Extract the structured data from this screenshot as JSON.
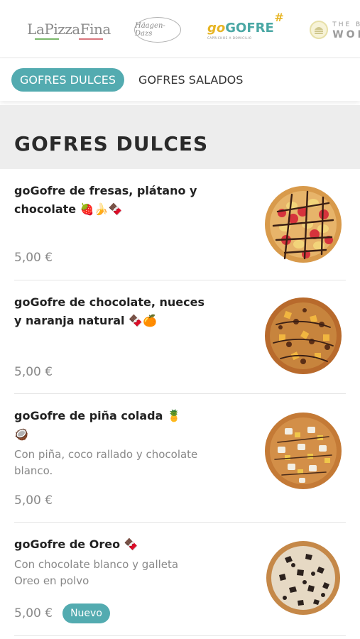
{
  "brands": {
    "lapizzafina": "LaPizzaFina",
    "haagen": "Häagen-Dazs",
    "gogofre_go": "go",
    "gogofre_gofre": "GOFRE",
    "gogofre_hash": "#",
    "gogofre_sub": "CAPRICHOS A DOMICILIO",
    "world_top": "THE BU",
    "world_bottom": "WOR"
  },
  "tabs": [
    {
      "label": "GOFRES DULCES",
      "active": true
    },
    {
      "label": "GOFRES SALADOS",
      "active": false
    }
  ],
  "section": {
    "title": "GOFRES DULCES"
  },
  "products": [
    {
      "title_line1": "goGofre de fresas, plátano y",
      "title_line2": "chocolate 🍓🍌🍫",
      "description": "",
      "price": "5,00 €",
      "badge": ""
    },
    {
      "title_line1": "goGofre de chocolate, nueces",
      "title_line2": "y naranja natural 🍫🍊",
      "description": "",
      "price": "5,00 €",
      "badge": ""
    },
    {
      "title_line1": "goGofre de piña colada 🍍",
      "title_line2": "🥥",
      "description": "Con piña, coco rallado y chocolate blanco.",
      "price": "5,00 €",
      "badge": ""
    },
    {
      "title_line1": "goGofre de Oreo 🍫",
      "title_line2": "",
      "description": "Con chocolate blanco y galleta Oreo en polvo",
      "price": "5,00 €",
      "badge": "Nuevo"
    }
  ],
  "colors": {
    "accent": "#53abb0",
    "price": "#888888",
    "section_bg": "#ededed",
    "gogofre_yellow": "#e7b524"
  }
}
